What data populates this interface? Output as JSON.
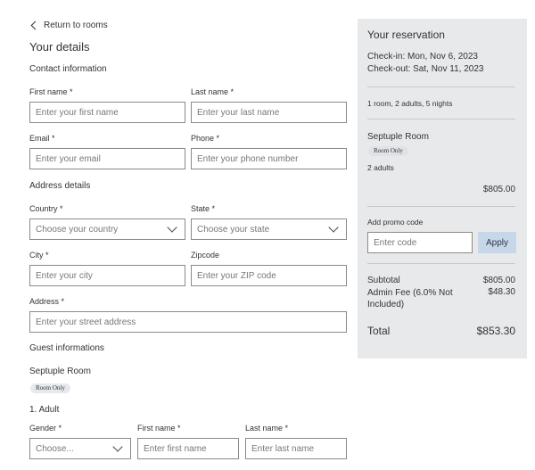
{
  "nav": {
    "back_label": "Return to rooms"
  },
  "details": {
    "title": "Your details",
    "contact_heading": "Contact information",
    "first_name": {
      "label": "First name *",
      "placeholder": "Enter your first name"
    },
    "last_name": {
      "label": "Last name *",
      "placeholder": "Enter your last name"
    },
    "email": {
      "label": "Email *",
      "placeholder": "Enter your email"
    },
    "phone": {
      "label": "Phone *",
      "placeholder": "Enter your phone number"
    },
    "address_heading": "Address details",
    "country": {
      "label": "Country *",
      "value": "Choose your country"
    },
    "state": {
      "label": "State *",
      "value": "Choose your state"
    },
    "city": {
      "label": "City *",
      "placeholder": "Enter your city"
    },
    "zipcode": {
      "label": "Zipcode",
      "placeholder": "Enter your ZIP code"
    },
    "address": {
      "label": "Address *",
      "placeholder": "Enter your street address"
    }
  },
  "guests": {
    "heading": "Guest informations",
    "room_name": "Septuple Room",
    "room_badge": "Room Only",
    "adult_heading": "1. Adult",
    "gender": {
      "label": "Gender *",
      "value": "Choose..."
    },
    "first_name": {
      "label": "First name *",
      "placeholder": "Enter first name"
    },
    "last_name": {
      "label": "Last name *",
      "placeholder": "Enter last name"
    }
  },
  "reservation": {
    "title": "Your reservation",
    "check_in": "Check-in: Mon, Nov 6, 2023",
    "check_out": "Check-out: Sat, Nov 11, 2023",
    "summary": "1 room, 2 adults, 5 nights",
    "room_name": "Septuple Room",
    "room_badge": "Room Only",
    "adults": "2 adults",
    "room_price": "$805.00",
    "promo_label": "Add promo code",
    "promo_placeholder": "Enter code",
    "apply_label": "Apply",
    "subtotal_label": "Subtotal",
    "subtotal_value": "$805.00",
    "fee_label": "Admin Fee (6.0% Not Included)",
    "fee_value": "$48.30",
    "total_label": "Total",
    "total_value": "$853.30"
  },
  "colors": {
    "panel_bg": "#e8e9eb",
    "apply_bg": "#c7d7ea",
    "border": "#8a8a8a"
  }
}
